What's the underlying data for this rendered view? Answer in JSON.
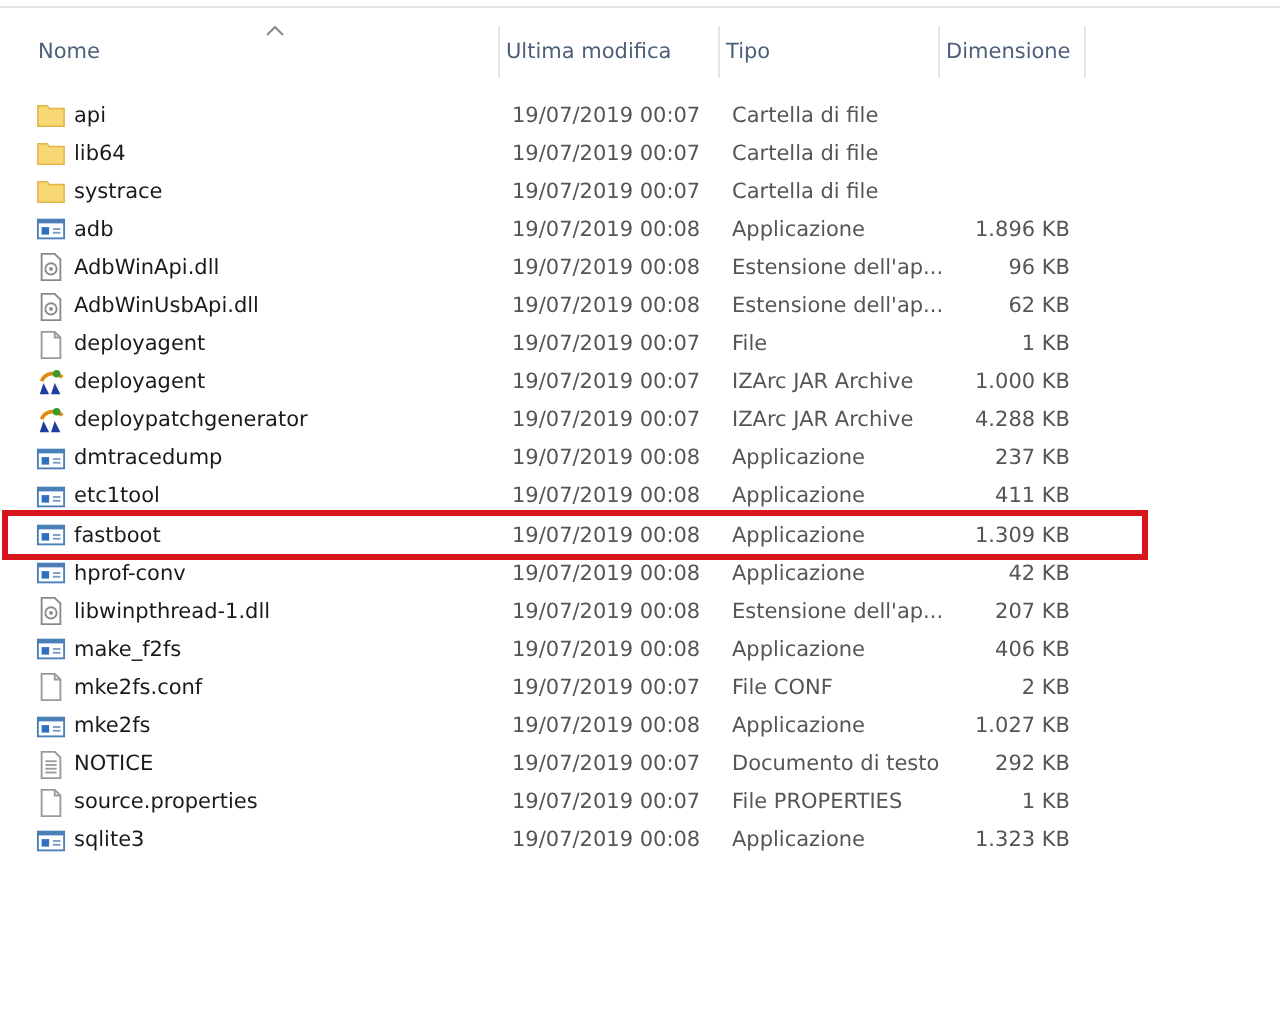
{
  "columns": [
    {
      "label": "Nome",
      "sorted": true
    },
    {
      "label": "Ultima modifica",
      "sorted": false
    },
    {
      "label": "Tipo",
      "sorted": false
    },
    {
      "label": "Dimensione",
      "sorted": false
    }
  ],
  "rows": [
    {
      "kind": "folder",
      "name": "api",
      "modified": "19/07/2019 00:07",
      "type": "Cartella di file",
      "highlighted": false
    },
    {
      "kind": "folder",
      "name": "lib64",
      "modified": "19/07/2019 00:07",
      "type": "Cartella di file",
      "highlighted": false
    },
    {
      "kind": "folder",
      "name": "systrace",
      "modified": "19/07/2019 00:07",
      "type": "Cartella di file",
      "highlighted": false
    },
    {
      "kind": "app",
      "name": "adb",
      "modified": "19/07/2019 00:08",
      "type": "Applicazione",
      "size": "1.896 KB",
      "highlighted": false
    },
    {
      "kind": "dll",
      "name": "AdbWinApi.dll",
      "modified": "19/07/2019 00:08",
      "type": "Estensione dell'ap...",
      "size": "96 KB",
      "highlighted": false
    },
    {
      "kind": "dll",
      "name": "AdbWinUsbApi.dll",
      "modified": "19/07/2019 00:08",
      "type": "Estensione dell'ap...",
      "size": "62 KB",
      "highlighted": false
    },
    {
      "kind": "file",
      "name": "deployagent",
      "modified": "19/07/2019 00:07",
      "type": "File",
      "size": "1 KB",
      "highlighted": false
    },
    {
      "kind": "jar",
      "name": "deployagent",
      "modified": "19/07/2019 00:07",
      "type": "IZArc JAR Archive",
      "size": "1.000 KB",
      "highlighted": false
    },
    {
      "kind": "jar",
      "name": "deploypatchgenerator",
      "modified": "19/07/2019 00:07",
      "type": "IZArc JAR Archive",
      "size": "4.288 KB",
      "highlighted": false
    },
    {
      "kind": "app",
      "name": "dmtracedump",
      "modified": "19/07/2019 00:08",
      "type": "Applicazione",
      "size": "237 KB",
      "highlighted": false
    },
    {
      "kind": "app",
      "name": "etc1tool",
      "modified": "19/07/2019 00:08",
      "type": "Applicazione",
      "size": "411 KB",
      "highlighted": false
    },
    {
      "kind": "app",
      "name": "fastboot",
      "modified": "19/07/2019 00:08",
      "type": "Applicazione",
      "size": "1.309 KB",
      "highlighted": true
    },
    {
      "kind": "app",
      "name": "hprof-conv",
      "modified": "19/07/2019 00:08",
      "type": "Applicazione",
      "size": "42 KB",
      "highlighted": false
    },
    {
      "kind": "dll",
      "name": "libwinpthread-1.dll",
      "modified": "19/07/2019 00:08",
      "type": "Estensione dell'ap...",
      "size": "207 KB",
      "highlighted": false
    },
    {
      "kind": "app",
      "name": "make_f2fs",
      "modified": "19/07/2019 00:08",
      "type": "Applicazione",
      "size": "406 KB",
      "highlighted": false
    },
    {
      "kind": "file",
      "name": "mke2fs.conf",
      "modified": "19/07/2019 00:07",
      "type": "File CONF",
      "size": "2 KB",
      "highlighted": false
    },
    {
      "kind": "app",
      "name": "mke2fs",
      "modified": "19/07/2019 00:08",
      "type": "Applicazione",
      "size": "1.027 KB",
      "highlighted": false
    },
    {
      "kind": "text",
      "name": "NOTICE",
      "modified": "19/07/2019 00:07",
      "type": "Documento di testo",
      "size": "292 KB",
      "highlighted": false
    },
    {
      "kind": "file",
      "name": "source.properties",
      "modified": "19/07/2019 00:07",
      "type": "File PROPERTIES",
      "size": "1 KB",
      "highlighted": false
    },
    {
      "kind": "app",
      "name": "sqlite3",
      "modified": "19/07/2019 00:08",
      "type": "Applicazione",
      "size": "1.323 KB",
      "highlighted": false
    }
  ]
}
